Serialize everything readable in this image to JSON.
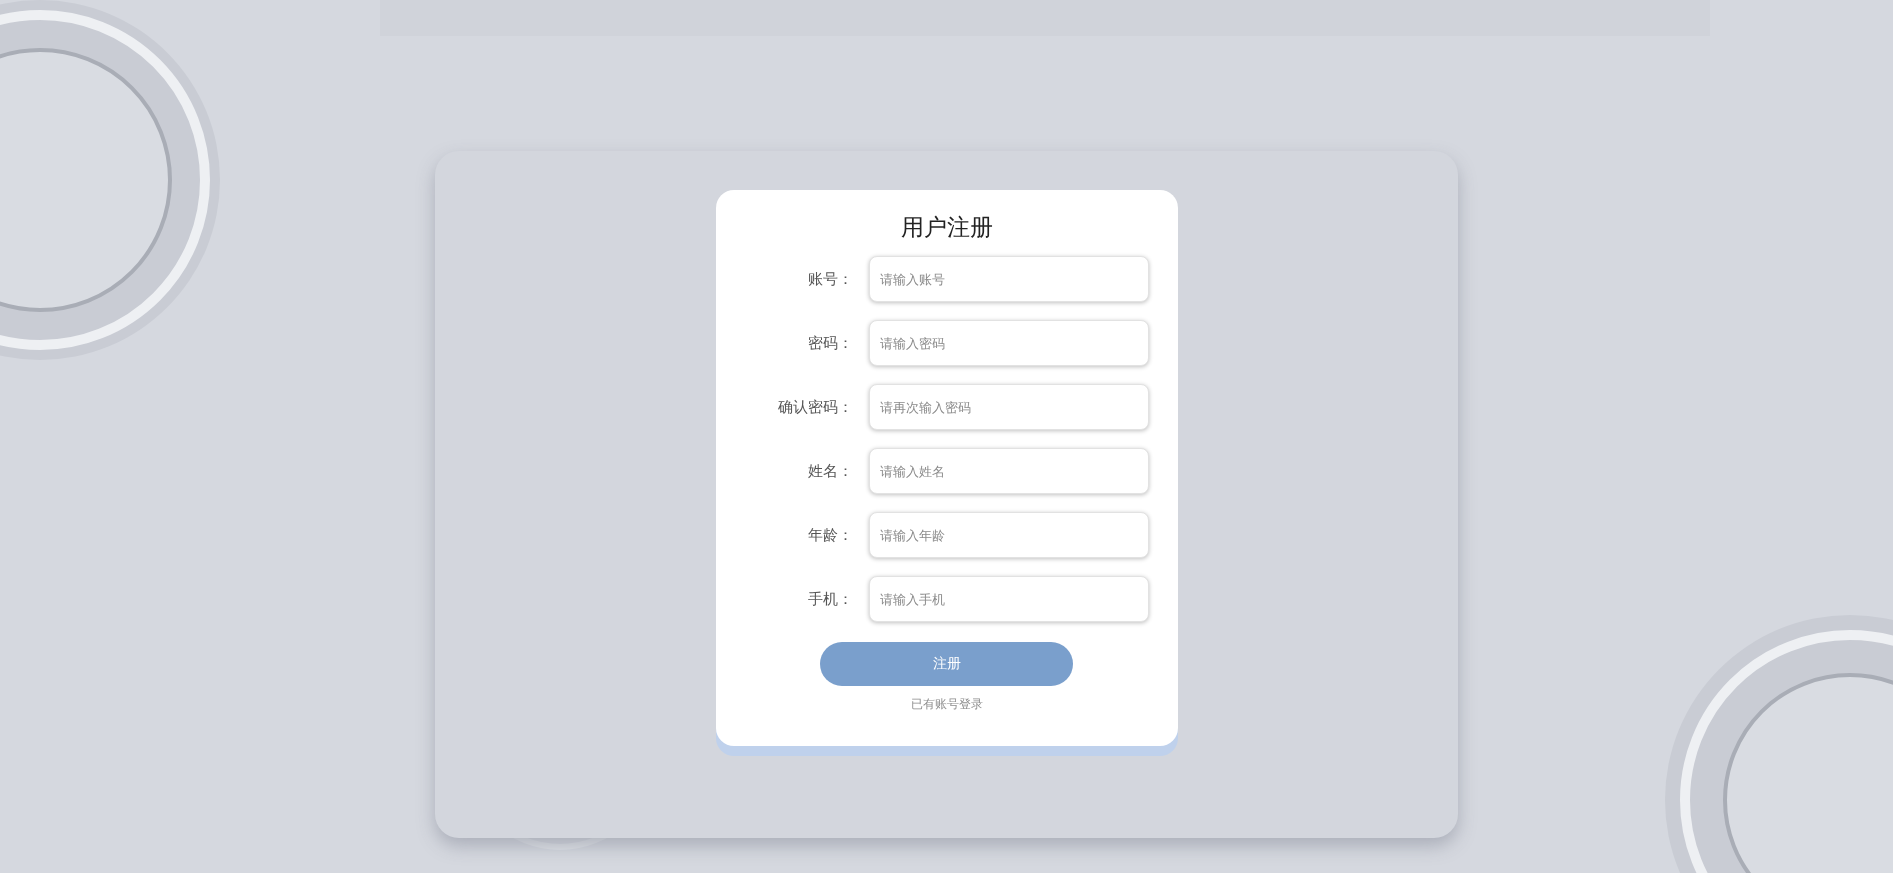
{
  "form": {
    "title": "用户注册",
    "fields": [
      {
        "label": "账号：",
        "placeholder": "请输入账号"
      },
      {
        "label": "密码：",
        "placeholder": "请输入密码"
      },
      {
        "label": "确认密码：",
        "placeholder": "请再次输入密码"
      },
      {
        "label": "姓名：",
        "placeholder": "请输入姓名"
      },
      {
        "label": "年龄：",
        "placeholder": "请输入年龄"
      },
      {
        "label": "手机：",
        "placeholder": "请输入手机"
      }
    ],
    "submit_button": "注册",
    "login_link": "已有账号登录"
  }
}
